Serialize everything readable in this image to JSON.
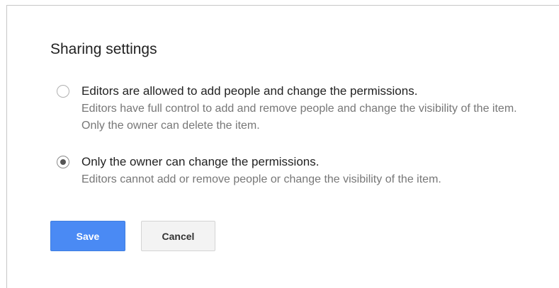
{
  "dialog": {
    "title": "Sharing settings",
    "options": [
      {
        "label": "Editors are allowed to add people and change the permissions.",
        "description": "Editors have full control to add and remove people and change the visibility of the item. Only the owner can delete the item.",
        "checked": false
      },
      {
        "label": "Only the owner can change the permissions.",
        "description": "Editors cannot add or remove people or change the visibility of the item.",
        "checked": true
      }
    ],
    "buttons": {
      "save_label": "Save",
      "cancel_label": "Cancel"
    }
  },
  "colors": {
    "primary_button": "#4a8af4",
    "secondary_button": "#f3f3f3",
    "title_text": "#222222",
    "description_text": "#777777"
  }
}
